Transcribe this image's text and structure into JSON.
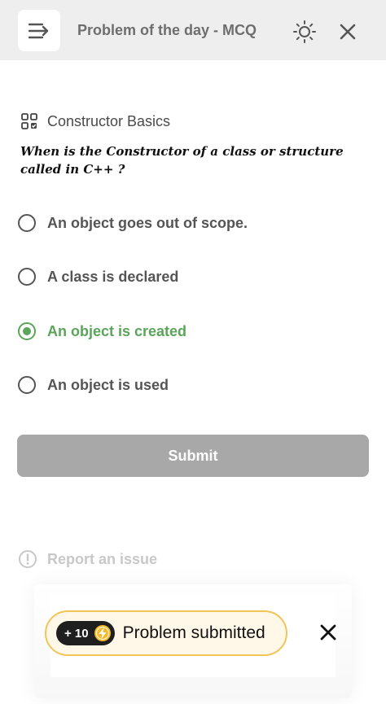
{
  "header": {
    "title": "Problem of the day - MCQ",
    "menu_icon": "menu-collapse-icon",
    "theme_icon": "sun-icon",
    "close_icon": "close-icon"
  },
  "question": {
    "topic": "Constructor Basics",
    "topic_icon": "grid-icon",
    "text": "When is the Constructor of a class or structure called in C++ ?"
  },
  "options": [
    {
      "label": "An object goes out of scope.",
      "selected": false
    },
    {
      "label": "A class is declared",
      "selected": false
    },
    {
      "label": "An object is created",
      "selected": true
    },
    {
      "label": "An object is used",
      "selected": false
    }
  ],
  "submit": {
    "label": "Submit"
  },
  "report": {
    "label": "Report an issue",
    "icon": "alert-circle-icon"
  },
  "toast": {
    "points": "+ 10",
    "points_icon": "lightning-icon",
    "message": "Problem submitted",
    "close_icon": "close-icon"
  },
  "colors": {
    "selected": "#5aa55a",
    "submit_disabled": "#a8a8a8",
    "toast_border": "#f2c557",
    "header_bg": "#eeeeee"
  }
}
